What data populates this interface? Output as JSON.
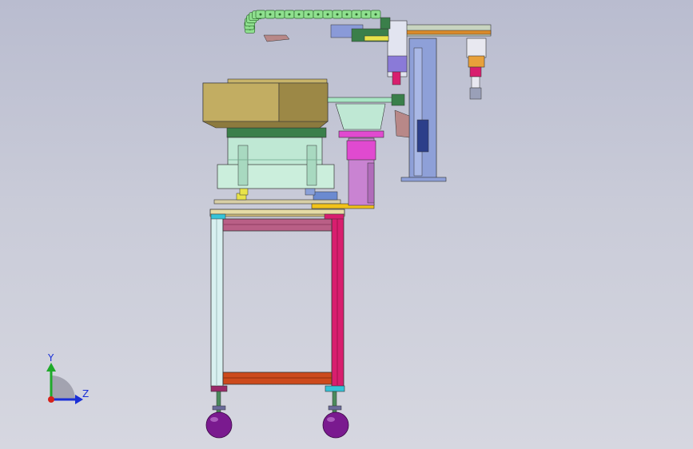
{
  "viewport": {
    "background_top": "#b9bccf",
    "background_bottom": "#d6d7e0"
  },
  "model": {
    "parts": [
      "vibratory-bowl-feeder",
      "bowl-base",
      "linear-feeder",
      "feeder-support-column",
      "machine-frame",
      "cable-drag-chain",
      "gantry-arm",
      "vertical-column",
      "pick-head",
      "leveling-feet"
    ],
    "colors": {
      "bowl": "#b09b52",
      "bowl_base": "#bfe8d4",
      "frame_left": "#d8f0f0",
      "frame_right": "#d81e6e",
      "frame_top_beam": "#b95f86",
      "frame_bottom_beam": "#cc4a1c",
      "column": "#8ea0d8",
      "feeder_support": "#d37ad8",
      "drag_chain": "#8fe08f",
      "feet": "#7a1a8f"
    }
  },
  "triad": {
    "y_label": "Y",
    "z_label": "Z",
    "y_color": "#1faa2a",
    "z_color": "#1a2fd6",
    "origin_color": "#d6221a"
  }
}
